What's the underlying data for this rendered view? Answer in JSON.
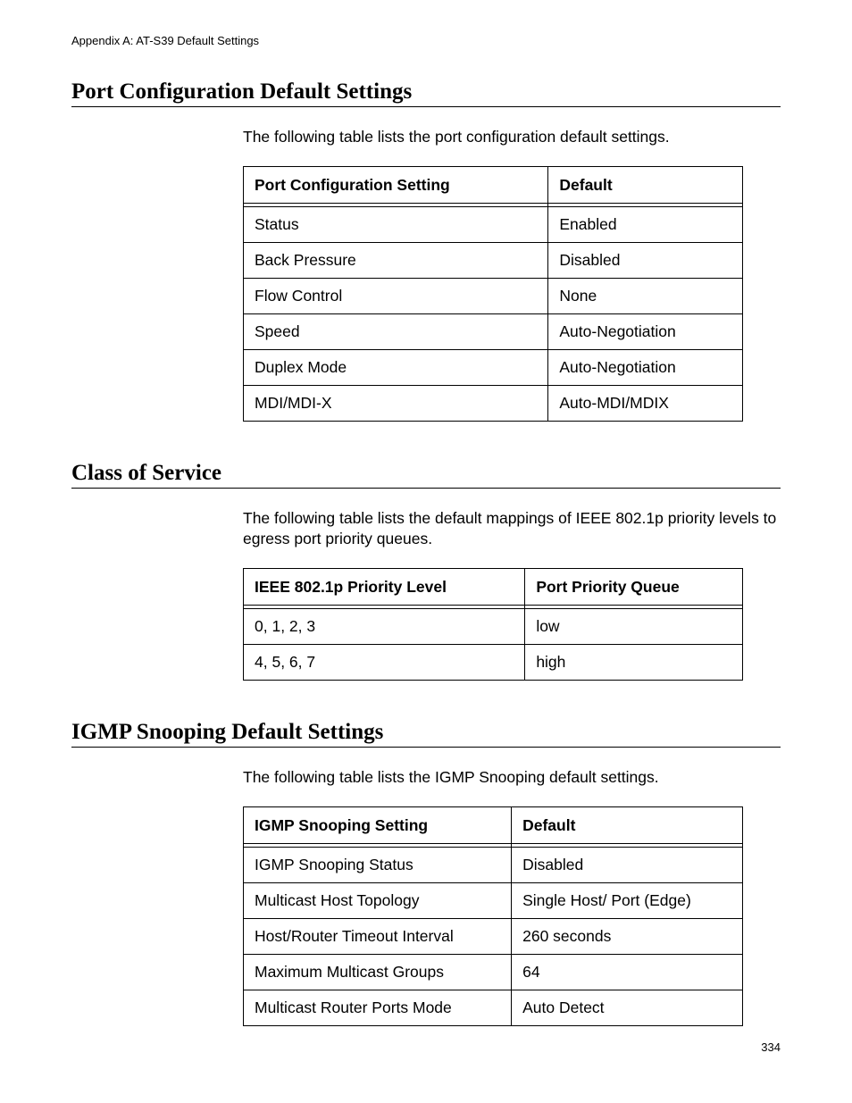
{
  "running_head": "Appendix A: AT-S39 Default Settings",
  "page_number": "334",
  "sections": [
    {
      "heading": "Port Configuration Default Settings",
      "intro": "The following table lists the port configuration default settings.",
      "table": {
        "headers": [
          "Port Configuration Setting",
          "Default"
        ],
        "rows": [
          [
            "Status",
            "Enabled"
          ],
          [
            "Back Pressure",
            "Disabled"
          ],
          [
            "Flow Control",
            "None"
          ],
          [
            "Speed",
            "Auto-Negotiation"
          ],
          [
            "Duplex Mode",
            "Auto-Negotiation"
          ],
          [
            "MDI/MDI-X",
            "Auto-MDI/MDIX"
          ]
        ]
      }
    },
    {
      "heading": "Class of Service",
      "intro": "The following table lists the default mappings of IEEE 802.1p priority levels to egress port priority queues.",
      "table": {
        "headers": [
          "IEEE 802.1p Priority Level",
          "Port Priority Queue"
        ],
        "rows": [
          [
            "0, 1, 2, 3",
            "low"
          ],
          [
            "4, 5, 6, 7",
            "high"
          ]
        ]
      }
    },
    {
      "heading": "IGMP Snooping Default Settings",
      "intro": "The following table lists the IGMP Snooping default settings.",
      "table": {
        "headers": [
          "IGMP Snooping Setting",
          "Default"
        ],
        "rows": [
          [
            "IGMP Snooping Status",
            "Disabled"
          ],
          [
            "Multicast Host Topology",
            "Single Host/ Port (Edge)"
          ],
          [
            "Host/Router Timeout Interval",
            "260 seconds"
          ],
          [
            "Maximum Multicast Groups",
            "64"
          ],
          [
            "Multicast Router Ports Mode",
            "Auto Detect"
          ]
        ]
      }
    }
  ]
}
